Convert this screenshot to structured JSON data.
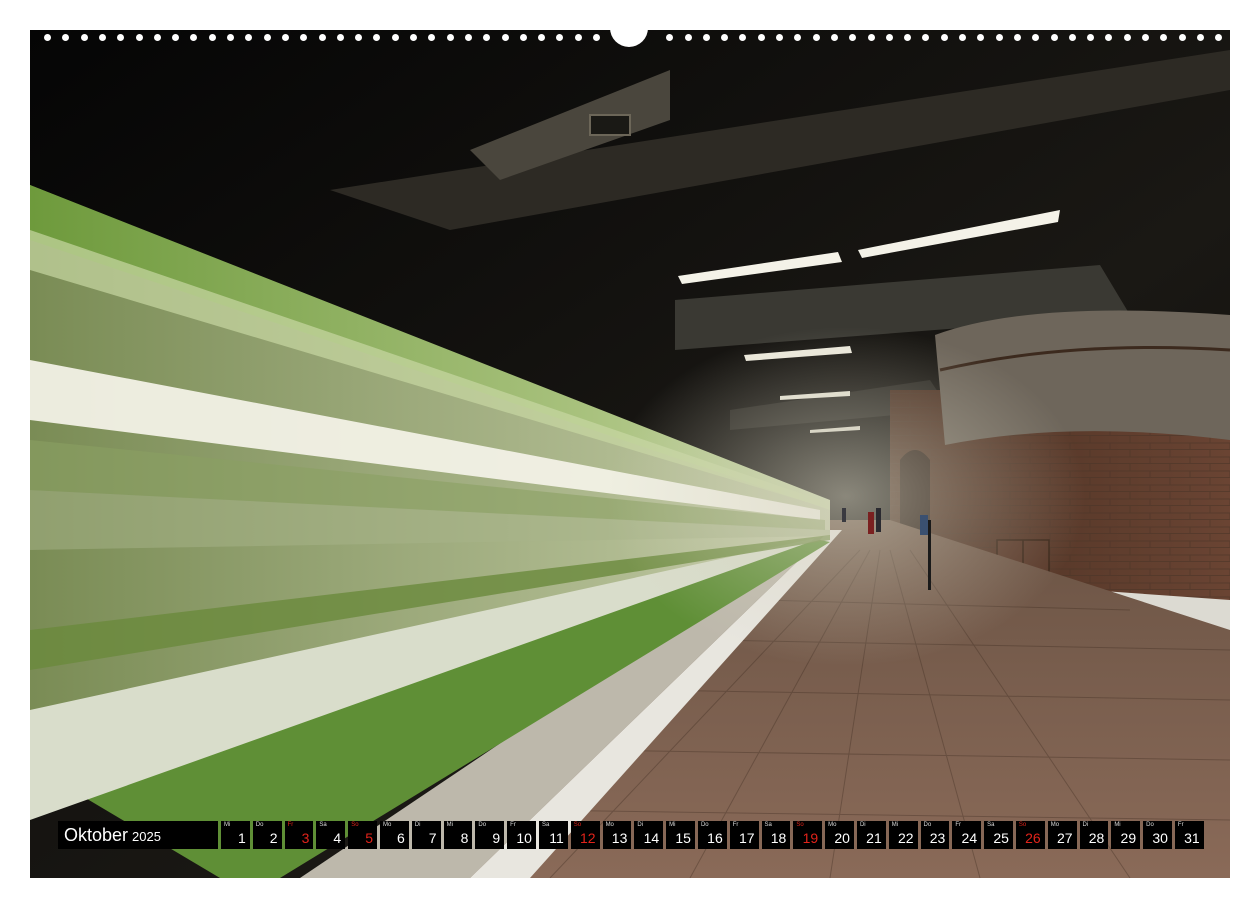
{
  "calendar": {
    "month": "Oktober",
    "year": "2025",
    "days": [
      {
        "wd": "Mi",
        "num": "1",
        "holiday": false
      },
      {
        "wd": "Do",
        "num": "2",
        "holiday": false
      },
      {
        "wd": "Fr",
        "num": "3",
        "holiday": true
      },
      {
        "wd": "Sa",
        "num": "4",
        "holiday": false
      },
      {
        "wd": "So",
        "num": "5",
        "holiday": true
      },
      {
        "wd": "Mo",
        "num": "6",
        "holiday": false
      },
      {
        "wd": "Di",
        "num": "7",
        "holiday": false
      },
      {
        "wd": "Mi",
        "num": "8",
        "holiday": false
      },
      {
        "wd": "Do",
        "num": "9",
        "holiday": false
      },
      {
        "wd": "Fr",
        "num": "10",
        "holiday": false
      },
      {
        "wd": "Sa",
        "num": "11",
        "holiday": false
      },
      {
        "wd": "So",
        "num": "12",
        "holiday": true
      },
      {
        "wd": "Mo",
        "num": "13",
        "holiday": false
      },
      {
        "wd": "Di",
        "num": "14",
        "holiday": false
      },
      {
        "wd": "Mi",
        "num": "15",
        "holiday": false
      },
      {
        "wd": "Do",
        "num": "16",
        "holiday": false
      },
      {
        "wd": "Fr",
        "num": "17",
        "holiday": false
      },
      {
        "wd": "Sa",
        "num": "18",
        "holiday": false
      },
      {
        "wd": "So",
        "num": "19",
        "holiday": true
      },
      {
        "wd": "Mo",
        "num": "20",
        "holiday": false
      },
      {
        "wd": "Di",
        "num": "21",
        "holiday": false
      },
      {
        "wd": "Mi",
        "num": "22",
        "holiday": false
      },
      {
        "wd": "Do",
        "num": "23",
        "holiday": false
      },
      {
        "wd": "Fr",
        "num": "24",
        "holiday": false
      },
      {
        "wd": "Sa",
        "num": "25",
        "holiday": false
      },
      {
        "wd": "So",
        "num": "26",
        "holiday": true
      },
      {
        "wd": "Mo",
        "num": "27",
        "holiday": false
      },
      {
        "wd": "Di",
        "num": "28",
        "holiday": false
      },
      {
        "wd": "Mi",
        "num": "29",
        "holiday": false
      },
      {
        "wd": "Do",
        "num": "30",
        "holiday": false
      },
      {
        "wd": "Fr",
        "num": "31",
        "holiday": false
      }
    ]
  },
  "colors": {
    "holiday": "#e2231a",
    "strip": "#000000",
    "train_green": "#8fb457"
  }
}
